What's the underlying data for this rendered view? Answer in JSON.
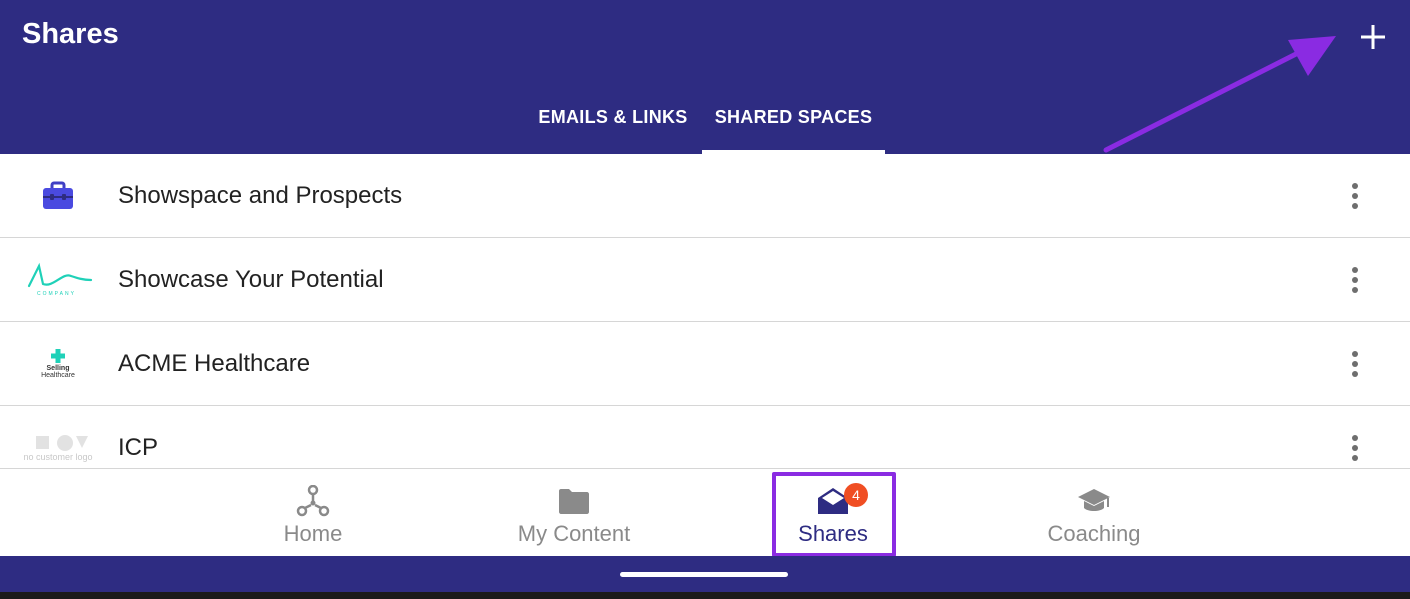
{
  "header": {
    "title": "Shares",
    "add_icon": "plus-icon"
  },
  "tabs": [
    {
      "label": "EMAILS & LINKS",
      "selected": false
    },
    {
      "label": "SHARED SPACES",
      "selected": true
    }
  ],
  "spaces": [
    {
      "name": "Showspace and Prospects",
      "logo": "briefcase-icon"
    },
    {
      "name": "Showcase Your Potential",
      "logo": "company-wave-logo",
      "logo_text": "COMPANY"
    },
    {
      "name": "ACME Healthcare",
      "logo": "selling-healthcare-logo",
      "logo_text_1": "Selling",
      "logo_text_2": "Healthcare"
    },
    {
      "name": "ICP",
      "logo": "no-customer-logo",
      "logo_text": "no customer logo"
    }
  ],
  "bottom_nav": [
    {
      "label": "Home",
      "icon": "hub-icon",
      "active": false
    },
    {
      "label": "My Content",
      "icon": "folder-icon",
      "active": false
    },
    {
      "label": "Shares",
      "icon": "open-envelope-icon",
      "active": true,
      "badge": "4"
    },
    {
      "label": "Coaching",
      "icon": "graduation-cap-icon",
      "active": false
    }
  ],
  "colors": {
    "brand": "#2e2c82",
    "annotation": "#8a2be2",
    "badge": "#f04e23",
    "teal": "#1fd1b8"
  }
}
